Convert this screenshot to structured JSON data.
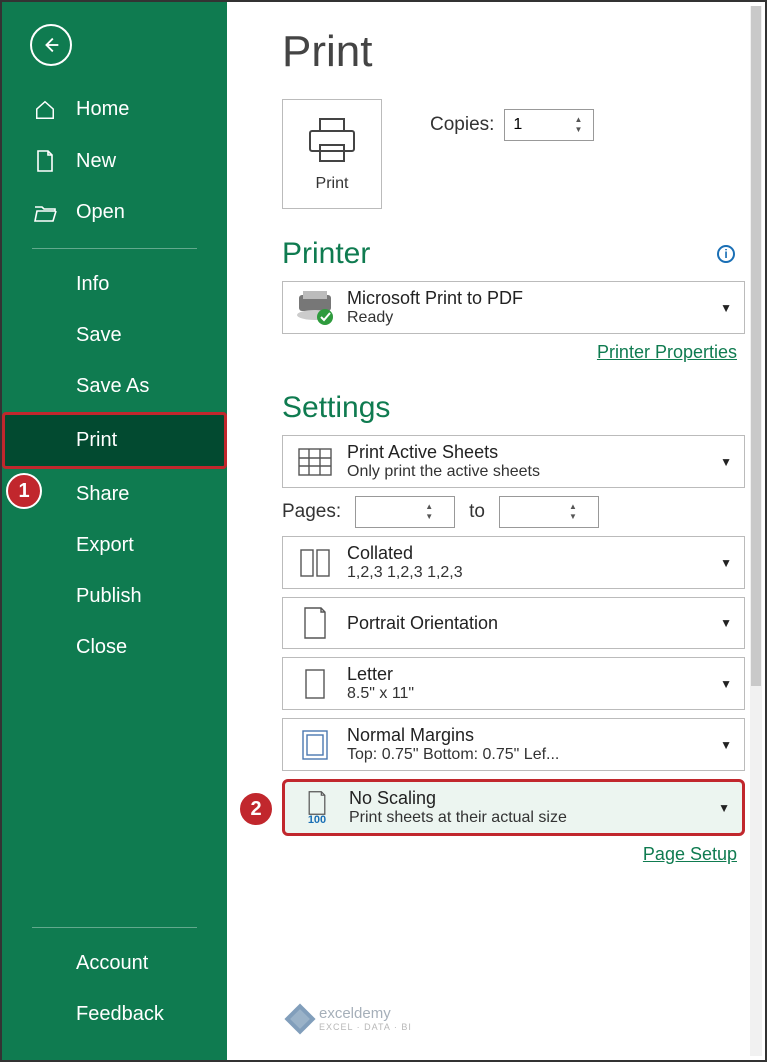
{
  "sidebar": {
    "back_aria": "Back",
    "items_top": [
      {
        "icon": "home",
        "label": "Home"
      },
      {
        "icon": "newdoc",
        "label": "New"
      },
      {
        "icon": "folder",
        "label": "Open"
      }
    ],
    "items_mid": [
      {
        "label": "Info"
      },
      {
        "label": "Save"
      },
      {
        "label": "Save As"
      },
      {
        "label": "Print",
        "selected": true
      },
      {
        "label": "Share"
      },
      {
        "label": "Export"
      },
      {
        "label": "Publish"
      },
      {
        "label": "Close"
      }
    ],
    "items_bottom": [
      {
        "label": "Account"
      },
      {
        "label": "Feedback"
      }
    ]
  },
  "main": {
    "title": "Print",
    "print_button": "Print",
    "copies_label": "Copies:",
    "copies_value": "1",
    "printer_header": "Printer",
    "printer": {
      "name": "Microsoft Print to PDF",
      "status": "Ready"
    },
    "printer_props_link": "Printer Properties",
    "settings_header": "Settings",
    "settings": {
      "sheets": {
        "title": "Print Active Sheets",
        "sub": "Only print the active sheets"
      },
      "pages_label": "Pages:",
      "pages_to": "to",
      "pages_from": "",
      "pages_to_val": "",
      "collate": {
        "title": "Collated",
        "sub": "1,2,3    1,2,3    1,2,3"
      },
      "orient": {
        "title": "Portrait Orientation",
        "sub": ""
      },
      "paper": {
        "title": "Letter",
        "sub": "8.5\" x 11\""
      },
      "margins": {
        "title": "Normal Margins",
        "sub": "Top: 0.75\" Bottom: 0.75\" Lef..."
      },
      "scaling": {
        "title": "No Scaling",
        "sub": "Print sheets at their actual size",
        "badge": "100"
      }
    },
    "page_setup_link": "Page Setup"
  },
  "callouts": {
    "one": "1",
    "two": "2"
  },
  "watermark": {
    "brand": "exceldemy",
    "tag": "EXCEL · DATA · BI"
  }
}
